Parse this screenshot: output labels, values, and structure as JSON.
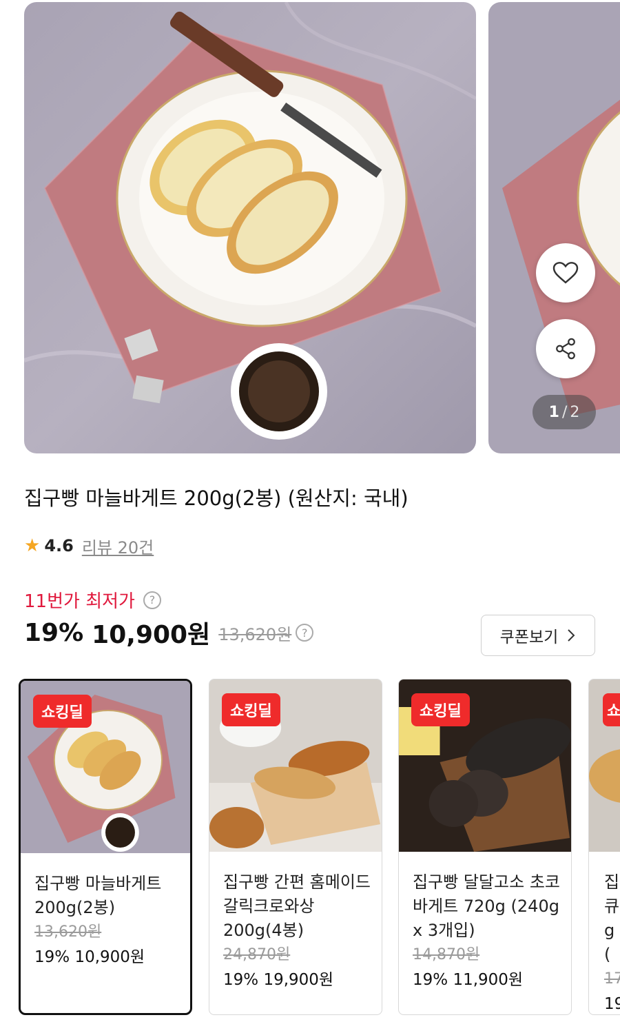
{
  "gallery": {
    "current_page": "1",
    "separator": "/",
    "total_pages": "2",
    "like_icon": "heart-icon",
    "share_icon": "share-icon"
  },
  "product": {
    "title": "집구빵 마늘바게트 200g(2봉) (원산지: 국내)",
    "rating": "4.6",
    "review_link": "리뷰 20건",
    "lowest_label": "11번가 최저가",
    "discount": "19%",
    "price": "10,900원",
    "original_price": "13,620원",
    "coupon_button": "쿠폰보기"
  },
  "options": [
    {
      "badge": "쇼킹딜",
      "name": "집구빵 마늘바게트 200g(2봉)",
      "original_price": "13,620원",
      "discount": "19%",
      "price": "10,900원",
      "selected": true
    },
    {
      "badge": "쇼킹딜",
      "name": "집구빵 간편 홈메이드 갈릭크로와상 200g(4봉)",
      "original_price": "24,870원",
      "discount": "19%",
      "price": "19,900원",
      "selected": false
    },
    {
      "badge": "쇼킹딜",
      "name": "집구빵 달달고소 초코바게트 720g (240g x 3개입)",
      "original_price": "14,870원",
      "discount": "19%",
      "price": "11,900원",
      "selected": false
    },
    {
      "badge": "쇼",
      "name": "집큐g(",
      "original_price": "17",
      "discount": "19",
      "price": "",
      "selected": false
    }
  ],
  "colors": {
    "accent_red": "#e0183c",
    "badge_red": "#ef2b2b",
    "star": "#f5a623"
  }
}
